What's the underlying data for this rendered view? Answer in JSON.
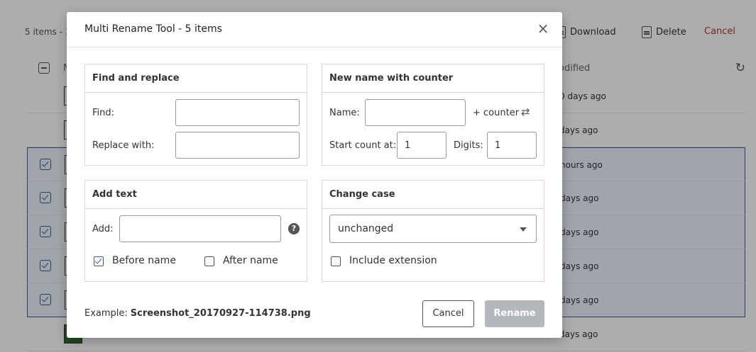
{
  "background": {
    "item_count": "5 items - 1",
    "actions": {
      "download": "Download",
      "delete": "Delete",
      "cancel": "Cancel"
    },
    "header": {
      "name": "N",
      "modified": "odified"
    },
    "rows": [
      {
        "date": "0 days ago",
        "selected": false
      },
      {
        "date": "days ago",
        "selected": false
      },
      {
        "date": "hours ago",
        "selected": true
      },
      {
        "date": "days ago",
        "selected": true
      },
      {
        "date": "days ago",
        "selected": true
      },
      {
        "date": "days ago",
        "selected": true
      },
      {
        "date": "days ago",
        "selected": true
      },
      {
        "date": "days ago",
        "selected": false
      }
    ]
  },
  "dialog": {
    "title": "Multi Rename Tool - 5 items",
    "find_replace": {
      "title": "Find and replace",
      "find_label": "Find:",
      "find_value": "",
      "replace_label": "Replace with:",
      "replace_value": ""
    },
    "counter": {
      "title": "New name with counter",
      "name_label": "Name:",
      "name_value": "",
      "counter_text": "+ counter",
      "start_label": "Start count at:",
      "start_value": "1",
      "digits_label": "Digits:",
      "digits_value": "1"
    },
    "add_text": {
      "title": "Add text",
      "add_label": "Add:",
      "add_value": "",
      "before_label": "Before name",
      "before_checked": true,
      "after_label": "After name",
      "after_checked": false
    },
    "change_case": {
      "title": "Change case",
      "selected": "unchanged",
      "include_ext_label": "Include extension",
      "include_ext_checked": false
    },
    "example_label": "Example:",
    "example_value": "Screenshot_20170927-114738.png",
    "cancel_label": "Cancel",
    "rename_label": "Rename"
  }
}
